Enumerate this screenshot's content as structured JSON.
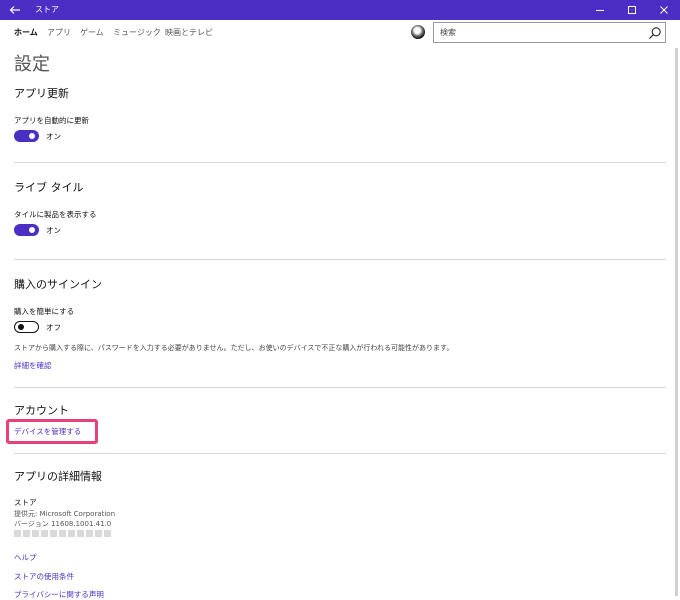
{
  "window": {
    "title": "ストア"
  },
  "nav": {
    "tabs": [
      {
        "label": "ホーム",
        "active": true
      },
      {
        "label": "アプリ",
        "active": false
      },
      {
        "label": "ゲーム",
        "active": false
      },
      {
        "label": "ミュージック",
        "active": false
      },
      {
        "label": "映画とテレビ",
        "active": false
      }
    ],
    "search_placeholder": "検索"
  },
  "page": {
    "heading": "設定"
  },
  "sections": {
    "app_updates": {
      "title": "アプリ更新",
      "setting_label": "アプリを自動的に更新",
      "toggle_state": "オン",
      "toggle_on": true
    },
    "live_tile": {
      "title": "ライブ タイル",
      "setting_label": "タイルに製品を表示する",
      "toggle_state": "オン",
      "toggle_on": true
    },
    "purchase_signin": {
      "title": "購入のサインイン",
      "setting_label": "購入を簡単にする",
      "toggle_state": "オフ",
      "toggle_on": false,
      "description": "ストアから購入する際に、パスワードを入力する必要がありません。ただし、お使いのデバイスで不正な購入が行われる可能性があります。",
      "details_link": "詳細を確認"
    },
    "account": {
      "title": "アカウント",
      "manage_devices_link": "デバイスを管理する"
    },
    "app_info": {
      "title": "アプリの詳細情報",
      "app_name": "ストア",
      "publisher": "提供元: Microsoft Corporation",
      "version": "バージョン 11608.1001.41.0",
      "links": {
        "help": "ヘルプ",
        "terms": "ストアの使用条件",
        "privacy": "プライバシーに関する声明"
      }
    }
  },
  "colors": {
    "accent": "#4b2fc4",
    "highlight": "#e8407a"
  },
  "icons": {
    "back": "back-arrow-icon",
    "minimize": "minimize-icon",
    "maximize": "maximize-icon",
    "close": "close-icon",
    "search": "search-icon",
    "avatar": "avatar"
  }
}
